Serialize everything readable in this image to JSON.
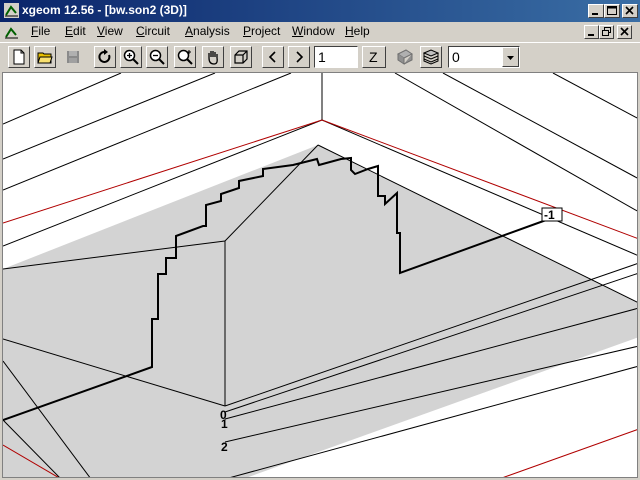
{
  "window": {
    "title": "xgeom 12.56 - [bw.son2 (3D)]",
    "controls": [
      "minimize",
      "maximize",
      "close"
    ]
  },
  "menubar": {
    "items": [
      "File",
      "Edit",
      "View",
      "Circuit",
      "Analysis",
      "Project",
      "Window",
      "Help"
    ],
    "underline_letters": [
      "F",
      "E",
      "V",
      "C",
      "A",
      "P",
      "W",
      "H"
    ]
  },
  "toolbar": {
    "level_value": "1",
    "z_label": "Z",
    "layer_value": "0"
  },
  "viewport": {
    "level_labels": [
      "0",
      "1",
      "2"
    ],
    "port_label": "-1"
  },
  "colors": {
    "title_start": "#0a246a",
    "title_end": "#3a6ea5",
    "chrome": "#d4d0c8",
    "substrate": "#d3d3d3",
    "box_edge": "#b00000",
    "trace": "#000000"
  }
}
